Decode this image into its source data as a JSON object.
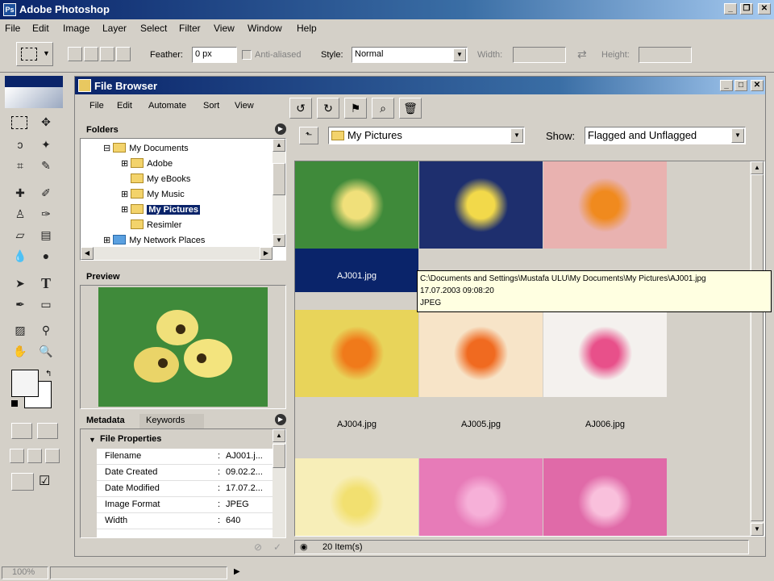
{
  "app": {
    "title": "Adobe Photoshop",
    "logo": "Ps"
  },
  "menu": [
    "File",
    "Edit",
    "Image",
    "Layer",
    "Select",
    "Filter",
    "View",
    "Window",
    "Help"
  ],
  "options": {
    "feather_label": "Feather:",
    "feather_value": "0 px",
    "antialias_label": "Anti-aliased",
    "style_label": "Style:",
    "style_value": "Normal",
    "width_label": "Width:",
    "height_label": "Height:"
  },
  "file_browser": {
    "title": "File Browser",
    "menu": [
      "File",
      "Edit",
      "Automate",
      "Sort",
      "View"
    ],
    "folders_tab": "Folders",
    "tree": [
      {
        "label": "My Documents",
        "indent": 0
      },
      {
        "label": "Adobe",
        "indent": 1
      },
      {
        "label": "My eBooks",
        "indent": 1
      },
      {
        "label": "My Music",
        "indent": 1
      },
      {
        "label": "My Pictures",
        "indent": 1,
        "selected": true
      },
      {
        "label": "Resimler",
        "indent": 1
      },
      {
        "label": "My Network Places",
        "indent": 0
      }
    ],
    "preview_tab": "Preview",
    "metadata_tab": "Metadata",
    "keywords_tab": "Keywords",
    "file_properties": "File Properties",
    "metadata": [
      {
        "key": "Filename",
        "value": "AJ001.j..."
      },
      {
        "key": "Date Created",
        "value": "09.02.2..."
      },
      {
        "key": "Date Modified",
        "value": "17.07.2..."
      },
      {
        "key": "Image Format",
        "value": "JPEG"
      },
      {
        "key": "Width",
        "value": "640"
      }
    ],
    "location": "My Pictures",
    "show_label": "Show:",
    "show_value": "Flagged and Unflagged",
    "thumbnails": [
      {
        "name": "AJ001.jpg",
        "selected": true,
        "bg": "#3f8a3a",
        "accent": "#f0e07a"
      },
      {
        "name": "",
        "bg": "#1e2f6e",
        "accent": "#f2d94a"
      },
      {
        "name": "",
        "bg": "#e9b2b0",
        "accent": "#f08a1e"
      },
      {
        "name": "AJ004.jpg",
        "bg": "#e8d45a",
        "accent": "#f07a1a"
      },
      {
        "name": "AJ005.jpg",
        "bg": "#f7e4c8",
        "accent": "#f06a20"
      },
      {
        "name": "AJ006.jpg",
        "bg": "#f4f1ee",
        "accent": "#e8508a"
      },
      {
        "name": "",
        "bg": "#f7eeb8",
        "accent": "#f2e070"
      },
      {
        "name": "",
        "bg": "#e77bb8",
        "accent": "#f6b0d8"
      },
      {
        "name": "",
        "bg": "#e06aa8",
        "accent": "#f9c0dc"
      }
    ],
    "tooltip": {
      "path": "C:\\Documents and Settings\\Mustafa ULU\\My Documents\\My Pictures\\AJ001.jpg",
      "date": "17.07.2003 09:08:20",
      "format": "JPEG"
    },
    "item_count": "20 Item(s)"
  },
  "status": {
    "zoom": "100%"
  }
}
